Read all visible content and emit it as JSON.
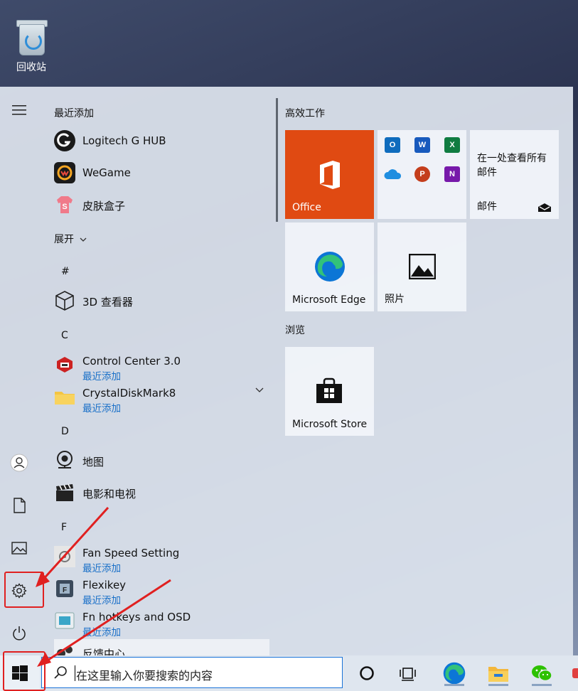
{
  "desktop": {
    "recycle_bin_label": "回收站"
  },
  "start_menu": {
    "recent_header": "最近添加",
    "recent_apps": [
      "Logitech G HUB",
      "WeGame",
      "皮肤盒子"
    ],
    "expand_label": "展开",
    "sections": [
      {
        "letter": "#",
        "apps": [
          {
            "name": "3D 查看器",
            "sub": ""
          }
        ]
      },
      {
        "letter": "C",
        "apps": [
          {
            "name": "Control Center 3.0",
            "sub": "最近添加"
          },
          {
            "name": "CrystalDiskMark8",
            "sub": "最近添加"
          }
        ]
      },
      {
        "letter": "D",
        "apps": [
          {
            "name": "地图",
            "sub": ""
          },
          {
            "name": "电影和电视",
            "sub": ""
          }
        ]
      },
      {
        "letter": "F",
        "apps": [
          {
            "name": "Fan Speed Setting",
            "sub": "最近添加"
          },
          {
            "name": "Flexikey",
            "sub": "最近添加"
          },
          {
            "name": "Fn hotkeys and OSD",
            "sub": "最近添加"
          },
          {
            "name": "反馈中心",
            "sub": ""
          }
        ]
      }
    ],
    "tile_groups": [
      {
        "title": "高效工作"
      },
      {
        "title": "浏览"
      }
    ],
    "tiles": {
      "office": "Office",
      "mail_text": "在一处查看所有邮件",
      "mail_label": "邮件",
      "edge": "Microsoft Edge",
      "photos": "照片",
      "store": "Microsoft Store"
    }
  },
  "taskbar": {
    "search_placeholder": "在这里输入你要搜索的内容"
  },
  "colors": {
    "office_tile": "#e04a12",
    "annotation_red": "#e02020",
    "recent_blue": "#1a70c8"
  }
}
